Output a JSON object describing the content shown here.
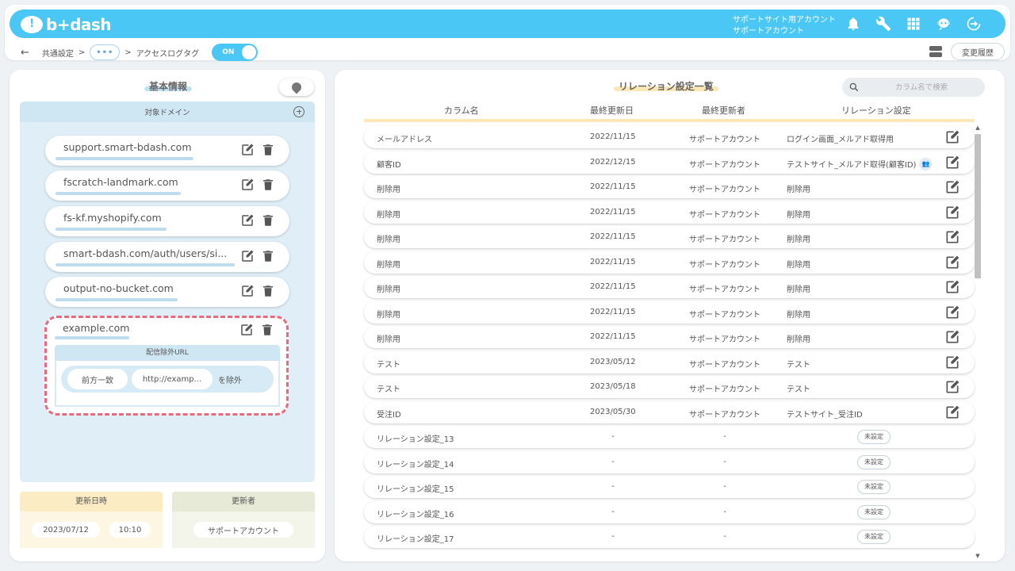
{
  "app": {
    "logo_text": "b+dash",
    "account_line1": "サポートサイト用アカウント",
    "account_line2": "サポートアカウント"
  },
  "breadcrumb": {
    "back": "←",
    "item1": "共通設定",
    "sep1": ">",
    "more": "•••",
    "sep2": ">",
    "item2": "アクセスログタグ",
    "toggle_label": "ON"
  },
  "history_button": "変更履歴",
  "basic_info": {
    "title": "基本情報",
    "domain_header": "対象ドメイン",
    "domains": [
      "support.smart-bdash.com",
      "fscratch-landmark.com",
      "fs-kf.myshopify.com",
      "smart-bdash.com/auth/users/si...",
      "output-no-bucket.com"
    ],
    "expanded_domain": "example.com",
    "exclusion_header": "配信除外URL",
    "exclusion_match": "前方一致",
    "exclusion_url": "http://examp...",
    "exclusion_suffix": "を除外",
    "updated_at_label": "更新日時",
    "updated_date": "2023/07/12",
    "updated_time": "10:10",
    "updated_by_label": "更新者",
    "updated_by": "サポートアカウント"
  },
  "relations": {
    "title": "リレーション設定一覧",
    "search_placeholder": "カラム名で検索",
    "columns": [
      "カラム名",
      "最終更新日",
      "最終更新者",
      "リレーション設定"
    ],
    "rows": [
      {
        "name": "メールアドレス",
        "date": "2022/11/15",
        "user": "サポートアカウント",
        "relation": "ログイン画面_メルアド取得用"
      },
      {
        "name": "顧客ID",
        "date": "2022/12/15",
        "user": "サポートアカウント",
        "relation": "テストサイト_メルアド取得(顧客ID)"
      },
      {
        "name": "削除用",
        "date": "2022/11/15",
        "user": "サポートアカウント",
        "relation": "削除用"
      },
      {
        "name": "削除用",
        "date": "2022/11/15",
        "user": "サポートアカウント",
        "relation": "削除用"
      },
      {
        "name": "削除用",
        "date": "2022/11/15",
        "user": "サポートアカウント",
        "relation": "削除用"
      },
      {
        "name": "削除用",
        "date": "2022/11/15",
        "user": "サポートアカウント",
        "relation": "削除用"
      },
      {
        "name": "削除用",
        "date": "2022/11/15",
        "user": "サポートアカウント",
        "relation": "削除用"
      },
      {
        "name": "削除用",
        "date": "2022/11/15",
        "user": "サポートアカウント",
        "relation": "削除用"
      },
      {
        "name": "削除用",
        "date": "2022/11/15",
        "user": "サポートアカウント",
        "relation": "削除用"
      },
      {
        "name": "テスト",
        "date": "2023/05/12",
        "user": "サポートアカウント",
        "relation": "テスト"
      },
      {
        "name": "テスト",
        "date": "2023/05/18",
        "user": "サポートアカウント",
        "relation": "テスト"
      },
      {
        "name": "受注ID",
        "date": "2023/05/30",
        "user": "サポートアカウント",
        "relation": "テストサイト_受注ID"
      },
      {
        "name": "リレーション設定_13",
        "date": "-",
        "user": "-",
        "relation": "未設定"
      },
      {
        "name": "リレーション設定_14",
        "date": "-",
        "user": "-",
        "relation": "未設定"
      },
      {
        "name": "リレーション設定_15",
        "date": "-",
        "user": "-",
        "relation": "未設定"
      },
      {
        "name": "リレーション設定_16",
        "date": "-",
        "user": "-",
        "relation": "未設定"
      },
      {
        "name": "リレーション設定_17",
        "date": "-",
        "user": "-",
        "relation": "未設定"
      }
    ]
  },
  "colors": {
    "accent": "#4ac7f5",
    "highlight_blue": "#bfe3f2",
    "highlight_yellow": "#fbe8b6",
    "dashed_border": "#e86a7c"
  },
  "icons": [
    "bell-icon",
    "wrench-icon",
    "grid-icon",
    "robot-icon",
    "logout-icon",
    "edit-icon",
    "trash-icon",
    "search-icon",
    "pin-icon",
    "plus-circle-icon",
    "database-icon",
    "group-icon"
  ]
}
